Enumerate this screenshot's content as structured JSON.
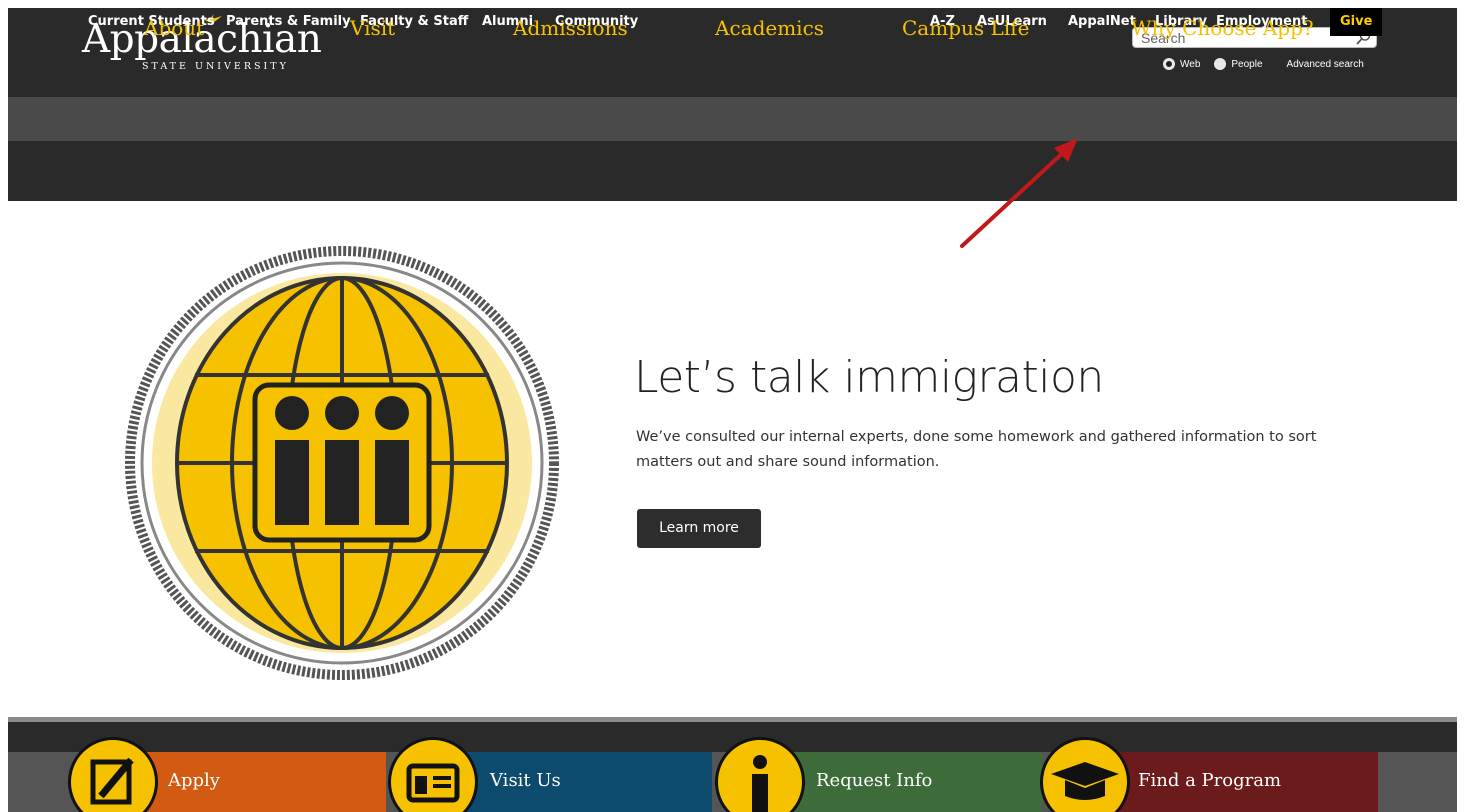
{
  "header": {
    "logo_word": "Appalachian",
    "logo_sub": "STATE UNIVERSITY",
    "search": {
      "placeholder": "Search",
      "options": [
        "Web",
        "People"
      ],
      "selected": "Web",
      "advanced": "Advanced search"
    }
  },
  "audience_nav": {
    "left": [
      "Current Students",
      "Parents & Family",
      "Faculty & Staff",
      "Alumni",
      "Community"
    ],
    "right": [
      "A-Z",
      "AsULearn",
      "AppalNet",
      "Library",
      "Employment"
    ],
    "give": "Give"
  },
  "main_nav": [
    "About",
    "Visit",
    "Admissions",
    "Academics",
    "Campus Life",
    "Why Choose App?"
  ],
  "hero": {
    "title": "Let’s talk immigration",
    "text": "We’ve consulted our internal experts, done some homework and gathered information to sort matters out and share sound information.",
    "button": "Learn more"
  },
  "cta": [
    {
      "label": "Apply",
      "color": "#d35a12",
      "icon": "pencil-notepad-icon"
    },
    {
      "label": "Visit Us",
      "color": "#0c4a6e",
      "icon": "id-badge-icon"
    },
    {
      "label": "Request Info",
      "color": "#3e6b3a",
      "icon": "info-icon"
    },
    {
      "label": "Find a Program",
      "color": "#6b1b1b",
      "icon": "graduation-cap-icon"
    }
  ],
  "colors": {
    "gold": "#f6c200",
    "dark": "#2a2a2a",
    "arrow": "#c0181b"
  }
}
